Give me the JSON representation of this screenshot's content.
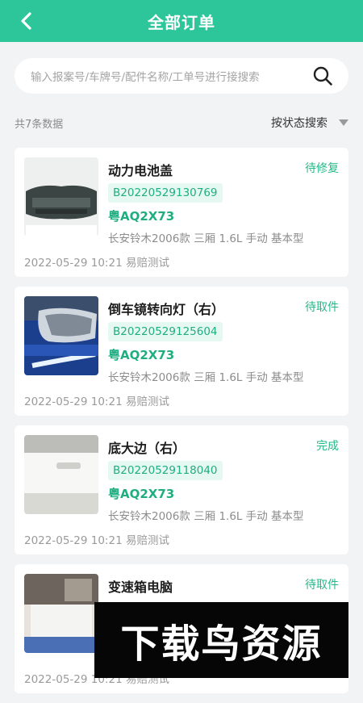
{
  "header": {
    "title": "全部订单",
    "back_icon": "chevron-left-icon"
  },
  "search": {
    "placeholder": "输入报案号/车牌号/配件名称/工单号进行接搜索",
    "icon": "search-icon"
  },
  "list_meta": {
    "count_text": "共7条数据",
    "filter_label": "按状态搜索",
    "filter_icon": "caret-down-icon"
  },
  "orders": [
    {
      "title": "动力电池盖",
      "status": "待修复",
      "code": "B20220529130769",
      "plate": "粤AQ2X73",
      "model": "长安铃木2006款 三厢 1.6L 手动 基本型",
      "time": "2022-05-29 10:21",
      "user": "易赔测试"
    },
    {
      "title": "倒车镜转向灯（右）",
      "status": "待取件",
      "code": "B20220529125604",
      "plate": "粤AQ2X73",
      "model": "长安铃木2006款 三厢 1.6L 手动 基本型",
      "time": "2022-05-29 10:21",
      "user": "易赔测试"
    },
    {
      "title": "底大边（右）",
      "status": "完成",
      "code": "B20220529118040",
      "plate": "粤AQ2X73",
      "model": "长安铃木2006款 三厢 1.6L 手动 基本型",
      "time": "2022-05-29 10:21",
      "user": "易赔测试"
    },
    {
      "title": "变速箱电脑",
      "status": "待取件",
      "code": "",
      "plate": "",
      "model": "",
      "time": "2022-05-29 10:21",
      "user": "易赔测试"
    }
  ],
  "watermark": {
    "text": "下载鸟资源"
  },
  "colors": {
    "accent": "#2cc69a",
    "status": "#27b88a",
    "code_bg": "#e6f8f2"
  }
}
